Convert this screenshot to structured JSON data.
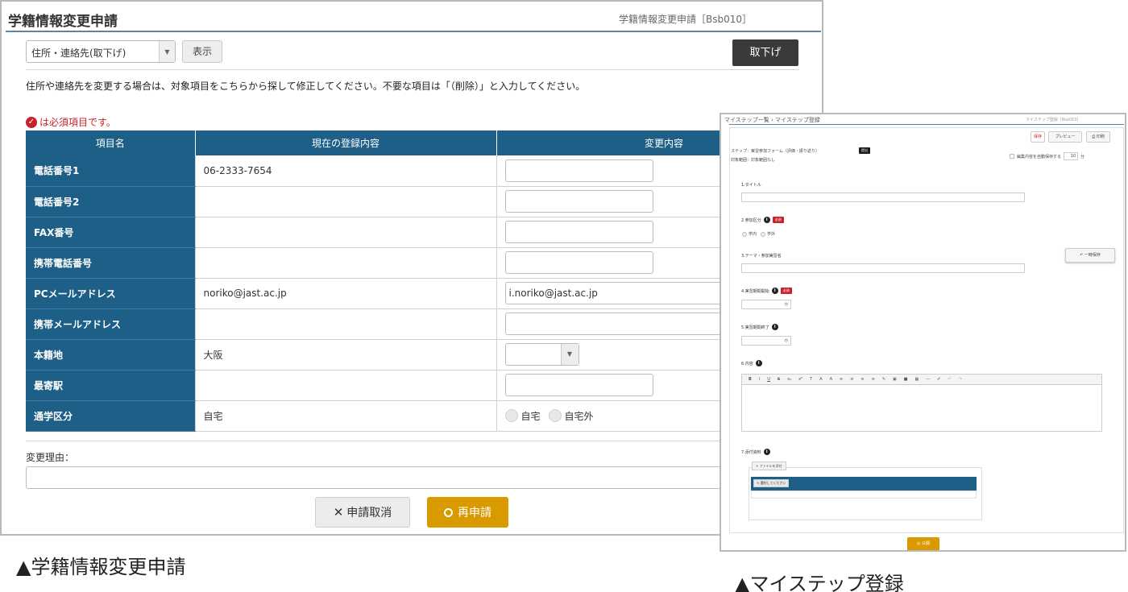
{
  "left": {
    "title": "学籍情報変更申請",
    "screen_id": "学籍情報変更申請［Bsb010］",
    "category_select": "住所・連絡先(取下げ)",
    "display_button": "表示",
    "withdraw_button": "取下げ",
    "instruction": "住所や連絡先を変更する場合は、対象項目をこちらから探して修正してください。不要な項目は「（削除）」と入力してください。",
    "required_note": "は必須項目です。",
    "table": {
      "headers": [
        "項目名",
        "現在の登録内容",
        "変更内容"
      ],
      "rows": [
        {
          "label": "電話番号1",
          "current": "06-2333-7654",
          "change": ""
        },
        {
          "label": "電話番号2",
          "current": "",
          "change": ""
        },
        {
          "label": "FAX番号",
          "current": "",
          "change": ""
        },
        {
          "label": "携帯電話番号",
          "current": "",
          "change": ""
        },
        {
          "label": "PCメールアドレス",
          "current": "noriko@jast.ac.jp",
          "change": "i.noriko@jast.ac.jp"
        },
        {
          "label": "携帯メールアドレス",
          "current": "",
          "change": ""
        },
        {
          "label": "本籍地",
          "current": "大阪",
          "change": ""
        },
        {
          "label": "最寄駅",
          "current": "",
          "change": ""
        },
        {
          "label": "通学区分",
          "current": "自宅",
          "options": [
            "自宅",
            "自宅外"
          ]
        }
      ]
    },
    "reason_label": "変更理由：",
    "cancel_button": "申請取消",
    "resubmit_button": "再申請",
    "caption": "▲学籍情報変更申請"
  },
  "right": {
    "title": "マイステップ一覧 › マイステップ登録",
    "screen_id": "マイステップ登録［Bsa010］",
    "buttons": {
      "save": "保存",
      "preview": "プレビュー",
      "print": "印刷"
    },
    "step_text": "ステップ：実習参加フォーム（評価・振り返り）",
    "step_badge": "提出",
    "target_text": "対象範囲：対象範囲なし",
    "autosave_text": "編集内容を自動保存する",
    "autosave_value": "10",
    "autosave_unit": "分",
    "field1": "1.タイトル",
    "field2": "2.参加区分",
    "required_badge": "必須",
    "radio_options": [
      "学内",
      "学外"
    ],
    "field3": "3.テーマ・参加実習名",
    "temp_save": "一時保存",
    "field4": "4.実習期間開始",
    "field5": "5.実習期間終了",
    "field6": "6.内容",
    "toolbar_items": [
      "B",
      "I",
      "U",
      "S",
      "x₂",
      "x²",
      "T",
      "A",
      "A",
      "≡",
      "≡",
      "≡",
      "≡",
      "✎",
      "▣",
      "■",
      "▦",
      "—",
      "✐",
      "↶",
      "↷"
    ],
    "field7": "7.添付資料",
    "file_button": "+ ファイルを添付",
    "file_chip": "× 選択してください",
    "publish_button": "公開",
    "caption": "▲マイステップ登録"
  }
}
